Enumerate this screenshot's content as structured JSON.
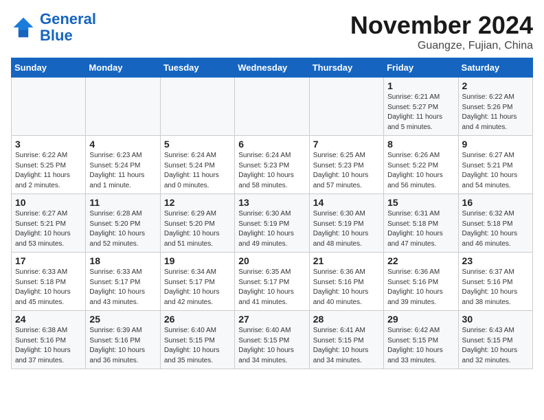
{
  "header": {
    "logo_line1": "General",
    "logo_line2": "Blue",
    "month_year": "November 2024",
    "location": "Guangze, Fujian, China"
  },
  "days_of_week": [
    "Sunday",
    "Monday",
    "Tuesday",
    "Wednesday",
    "Thursday",
    "Friday",
    "Saturday"
  ],
  "weeks": [
    [
      {
        "day": "",
        "info": ""
      },
      {
        "day": "",
        "info": ""
      },
      {
        "day": "",
        "info": ""
      },
      {
        "day": "",
        "info": ""
      },
      {
        "day": "",
        "info": ""
      },
      {
        "day": "1",
        "info": "Sunrise: 6:21 AM\nSunset: 5:27 PM\nDaylight: 11 hours\nand 5 minutes."
      },
      {
        "day": "2",
        "info": "Sunrise: 6:22 AM\nSunset: 5:26 PM\nDaylight: 11 hours\nand 4 minutes."
      }
    ],
    [
      {
        "day": "3",
        "info": "Sunrise: 6:22 AM\nSunset: 5:25 PM\nDaylight: 11 hours\nand 2 minutes."
      },
      {
        "day": "4",
        "info": "Sunrise: 6:23 AM\nSunset: 5:24 PM\nDaylight: 11 hours\nand 1 minute."
      },
      {
        "day": "5",
        "info": "Sunrise: 6:24 AM\nSunset: 5:24 PM\nDaylight: 11 hours\nand 0 minutes."
      },
      {
        "day": "6",
        "info": "Sunrise: 6:24 AM\nSunset: 5:23 PM\nDaylight: 10 hours\nand 58 minutes."
      },
      {
        "day": "7",
        "info": "Sunrise: 6:25 AM\nSunset: 5:23 PM\nDaylight: 10 hours\nand 57 minutes."
      },
      {
        "day": "8",
        "info": "Sunrise: 6:26 AM\nSunset: 5:22 PM\nDaylight: 10 hours\nand 56 minutes."
      },
      {
        "day": "9",
        "info": "Sunrise: 6:27 AM\nSunset: 5:21 PM\nDaylight: 10 hours\nand 54 minutes."
      }
    ],
    [
      {
        "day": "10",
        "info": "Sunrise: 6:27 AM\nSunset: 5:21 PM\nDaylight: 10 hours\nand 53 minutes."
      },
      {
        "day": "11",
        "info": "Sunrise: 6:28 AM\nSunset: 5:20 PM\nDaylight: 10 hours\nand 52 minutes."
      },
      {
        "day": "12",
        "info": "Sunrise: 6:29 AM\nSunset: 5:20 PM\nDaylight: 10 hours\nand 51 minutes."
      },
      {
        "day": "13",
        "info": "Sunrise: 6:30 AM\nSunset: 5:19 PM\nDaylight: 10 hours\nand 49 minutes."
      },
      {
        "day": "14",
        "info": "Sunrise: 6:30 AM\nSunset: 5:19 PM\nDaylight: 10 hours\nand 48 minutes."
      },
      {
        "day": "15",
        "info": "Sunrise: 6:31 AM\nSunset: 5:18 PM\nDaylight: 10 hours\nand 47 minutes."
      },
      {
        "day": "16",
        "info": "Sunrise: 6:32 AM\nSunset: 5:18 PM\nDaylight: 10 hours\nand 46 minutes."
      }
    ],
    [
      {
        "day": "17",
        "info": "Sunrise: 6:33 AM\nSunset: 5:18 PM\nDaylight: 10 hours\nand 45 minutes."
      },
      {
        "day": "18",
        "info": "Sunrise: 6:33 AM\nSunset: 5:17 PM\nDaylight: 10 hours\nand 43 minutes."
      },
      {
        "day": "19",
        "info": "Sunrise: 6:34 AM\nSunset: 5:17 PM\nDaylight: 10 hours\nand 42 minutes."
      },
      {
        "day": "20",
        "info": "Sunrise: 6:35 AM\nSunset: 5:17 PM\nDaylight: 10 hours\nand 41 minutes."
      },
      {
        "day": "21",
        "info": "Sunrise: 6:36 AM\nSunset: 5:16 PM\nDaylight: 10 hours\nand 40 minutes."
      },
      {
        "day": "22",
        "info": "Sunrise: 6:36 AM\nSunset: 5:16 PM\nDaylight: 10 hours\nand 39 minutes."
      },
      {
        "day": "23",
        "info": "Sunrise: 6:37 AM\nSunset: 5:16 PM\nDaylight: 10 hours\nand 38 minutes."
      }
    ],
    [
      {
        "day": "24",
        "info": "Sunrise: 6:38 AM\nSunset: 5:16 PM\nDaylight: 10 hours\nand 37 minutes."
      },
      {
        "day": "25",
        "info": "Sunrise: 6:39 AM\nSunset: 5:16 PM\nDaylight: 10 hours\nand 36 minutes."
      },
      {
        "day": "26",
        "info": "Sunrise: 6:40 AM\nSunset: 5:15 PM\nDaylight: 10 hours\nand 35 minutes."
      },
      {
        "day": "27",
        "info": "Sunrise: 6:40 AM\nSunset: 5:15 PM\nDaylight: 10 hours\nand 34 minutes."
      },
      {
        "day": "28",
        "info": "Sunrise: 6:41 AM\nSunset: 5:15 PM\nDaylight: 10 hours\nand 34 minutes."
      },
      {
        "day": "29",
        "info": "Sunrise: 6:42 AM\nSunset: 5:15 PM\nDaylight: 10 hours\nand 33 minutes."
      },
      {
        "day": "30",
        "info": "Sunrise: 6:43 AM\nSunset: 5:15 PM\nDaylight: 10 hours\nand 32 minutes."
      }
    ]
  ]
}
